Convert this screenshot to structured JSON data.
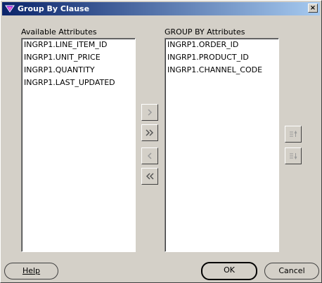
{
  "window": {
    "title": "Group By Clause",
    "close_label": "×"
  },
  "available": {
    "label": "Available Attributes",
    "items": [
      "INGRP1.LINE_ITEM_ID",
      "INGRP1.UNIT_PRICE",
      "INGRP1.QUANTITY",
      "INGRP1.LAST_UPDATED"
    ]
  },
  "groupby": {
    "label": "GROUP BY Attributes",
    "items": [
      "INGRP1.ORDER_ID",
      "INGRP1.PRODUCT_ID",
      "INGRP1.CHANNEL_CODE"
    ]
  },
  "shuttle": {
    "move_one": "chevron-right-icon",
    "move_all": "double-chevron-right-icon",
    "remove_one": "chevron-left-icon",
    "remove_all": "double-chevron-left-icon"
  },
  "order": {
    "up": "move-up-icon",
    "down": "move-down-icon"
  },
  "buttons": {
    "help": "Help",
    "ok": "OK",
    "cancel": "Cancel"
  },
  "colors": {
    "titlebar_start": "#0a246a",
    "titlebar_end": "#a6caf0",
    "face": "#d4d0c8"
  }
}
